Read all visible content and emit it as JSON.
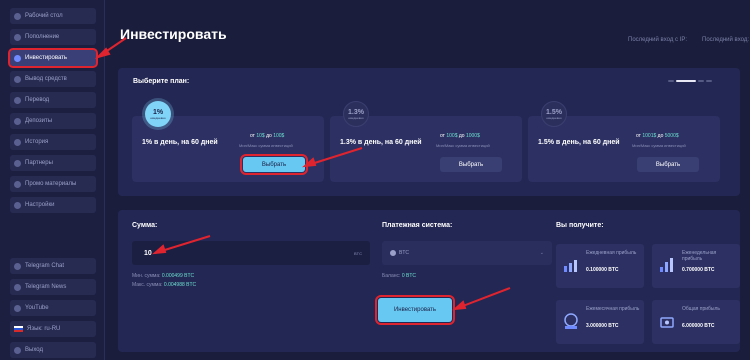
{
  "sidebar": {
    "items": [
      {
        "label": "Рабочий стол",
        "icon": "dashboard-icon"
      },
      {
        "label": "Пополнение",
        "icon": "wallet-icon"
      },
      {
        "label": "Инвестировать",
        "icon": "invest-icon",
        "active": true
      },
      {
        "label": "Вывод средств",
        "icon": "withdraw-icon"
      },
      {
        "label": "Перевод",
        "icon": "transfer-icon"
      },
      {
        "label": "Депозиты",
        "icon": "deposits-icon"
      },
      {
        "label": "История",
        "icon": "history-icon"
      },
      {
        "label": "Партнеры",
        "icon": "partners-icon"
      },
      {
        "label": "Промо материалы",
        "icon": "promo-icon"
      },
      {
        "label": "Настройки",
        "icon": "settings-icon"
      }
    ],
    "bottom_items": [
      {
        "label": "Telegram Chat",
        "icon": "telegram-icon"
      },
      {
        "label": "Telegram News",
        "icon": "telegram-icon"
      },
      {
        "label": "YouTube",
        "icon": "youtube-icon"
      },
      {
        "label": "Язык: ru-RU",
        "icon": "flag-ru-icon"
      },
      {
        "label": "Выход",
        "icon": "logout-icon"
      }
    ]
  },
  "header": {
    "title": "Инвестировать",
    "last_login_ip": "Последний вход с IP:",
    "last_login": "Последний вход:"
  },
  "plans": {
    "label": "Выберите план:",
    "items": [
      {
        "badge": "1%",
        "badge_sub": "ежедневно",
        "name": "1% в день, на 60 дней",
        "range_prefix": "от",
        "range_min": "10$",
        "range_mid": "до",
        "range_max": "100$",
        "minmax": "Мин/Макс сумма инвестиций",
        "button": "Выбрать",
        "selected": true
      },
      {
        "badge": "1.3%",
        "badge_sub": "ежедневно",
        "name": "1.3% в день, на 60 дней",
        "range_prefix": "от",
        "range_min": "100$",
        "range_mid": "до",
        "range_max": "1000$",
        "minmax": "Мин/Макс сумма инвестиций",
        "button": "Выбрать",
        "selected": false
      },
      {
        "badge": "1.5%",
        "badge_sub": "ежедневно",
        "name": "1.5% в день, на 60 дней",
        "range_prefix": "от",
        "range_min": "1001$",
        "range_mid": "до",
        "range_max": "5000$",
        "minmax": "Мин/Макс сумма инвестиций",
        "button": "Выбрать",
        "selected": false
      }
    ]
  },
  "amount": {
    "label": "Сумма:",
    "value": "10",
    "currency": "BTC",
    "min_label": "Мин. сумма:",
    "min_value": "0.000499 BTC",
    "max_label": "Макс. сумма:",
    "max_value": "0.004988 BTC"
  },
  "payment": {
    "label": "Платежная система:",
    "value": "BTC",
    "balance_label": "Баланс:",
    "balance_value": "0 BTC"
  },
  "invest_button": "Инвестировать",
  "receive": {
    "label": "Вы получите:",
    "stats": [
      {
        "label": "Ежедневная прибыль",
        "value": "0.100000 BTC",
        "icon": "daily-profit-icon"
      },
      {
        "label": "Еженедельная прибыль",
        "value": "0.700000 BTC",
        "icon": "weekly-profit-icon"
      },
      {
        "label": "Ежемесячная прибыль",
        "value": "3.000000 BTC",
        "icon": "monthly-profit-icon"
      },
      {
        "label": "Общая прибыль",
        "value": "6.000000 BTC",
        "icon": "total-profit-icon"
      }
    ]
  },
  "colors": {
    "background": "#1a1d3b",
    "accent": "#67c9f2",
    "highlight": "#e0242f",
    "range": "#6ee0d2"
  }
}
